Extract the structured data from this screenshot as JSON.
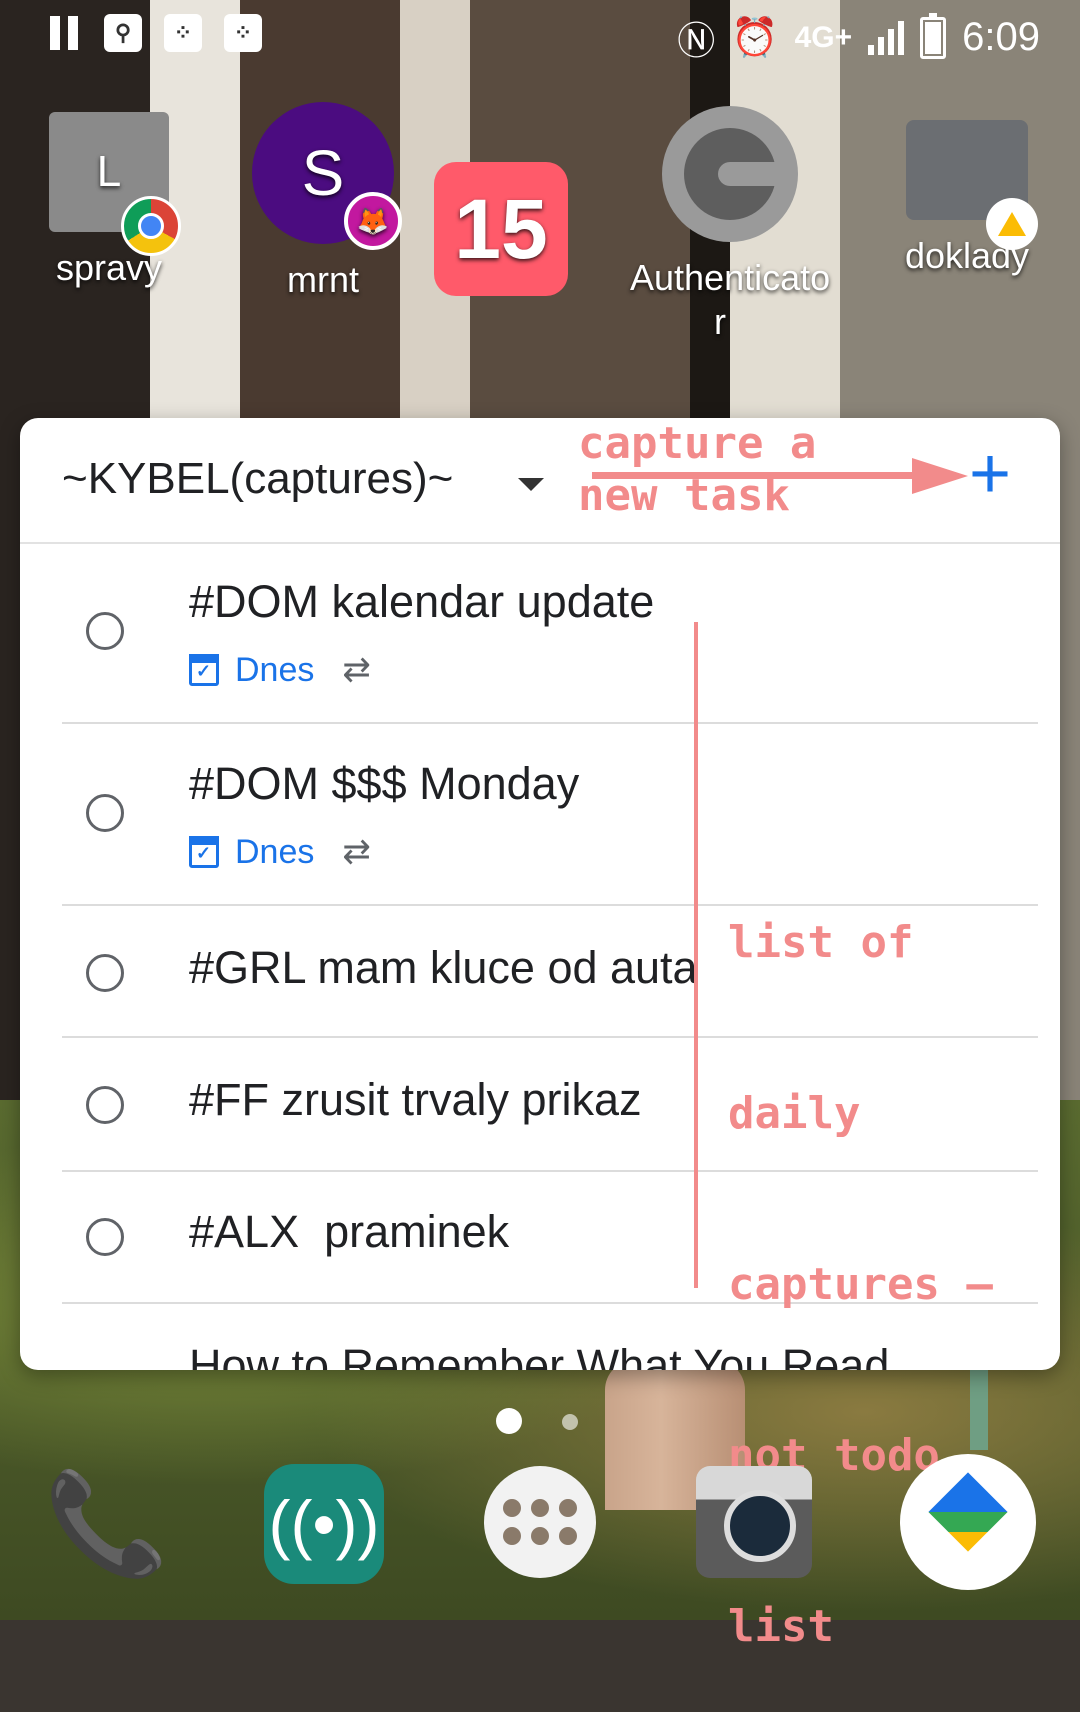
{
  "status_bar": {
    "network": "4G+",
    "time": "6:09"
  },
  "home_apps": [
    {
      "letter": "L",
      "label": "spravy",
      "color": "#8a8a8a"
    },
    {
      "letter": "S",
      "label": "mrnt",
      "color": "#4b0c80"
    },
    {
      "number": "15",
      "label": "",
      "color": "#ff5a6a"
    },
    {
      "label": "Authenticato r"
    },
    {
      "label": "doklady"
    }
  ],
  "widget": {
    "list_title": "~KYBEL(captures)~",
    "tasks": [
      {
        "title": "#DOM kalendar update",
        "due": "Dnes"
      },
      {
        "title": "#DOM $$$ Monday",
        "due": "Dnes"
      },
      {
        "title": "#GRL mam kluce od auta"
      },
      {
        "title": "#FF zrusit trvaly prikaz"
      },
      {
        "title": "#ALX  praminek"
      },
      {
        "title": "How to Remember What You Read"
      }
    ]
  },
  "annotations": {
    "capture_line1": "capture a",
    "capture_line2": "new task",
    "list_note": [
      "list of",
      "daily",
      "captures —",
      "not todo",
      "list"
    ],
    "color": "#f28b8b"
  },
  "dock": [
    "phone-icon",
    "radio-icon",
    "app-drawer-icon",
    "camera-icon",
    "maps-icon"
  ]
}
